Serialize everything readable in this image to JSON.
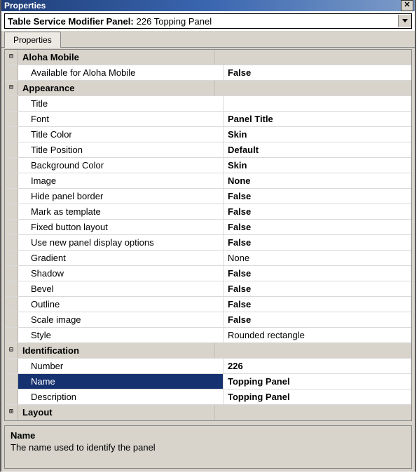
{
  "window": {
    "title": "Properties"
  },
  "selector": {
    "label": "Table Service Modifier Panel:",
    "value": "226 Topping Panel"
  },
  "tabs": [
    {
      "label": "Properties"
    }
  ],
  "groups": {
    "alohaMobile": {
      "title": "Aloha Mobile",
      "items": [
        {
          "label": "Available for Aloha Mobile",
          "value": "False",
          "bold": true
        }
      ]
    },
    "appearance": {
      "title": "Appearance",
      "items": [
        {
          "label": "Title",
          "value": "",
          "bold": false
        },
        {
          "label": "Font",
          "value": "Panel Title",
          "bold": true
        },
        {
          "label": "Title Color",
          "value": "Skin",
          "bold": true
        },
        {
          "label": "Title Position",
          "value": "Default",
          "bold": true
        },
        {
          "label": "Background Color",
          "value": "Skin",
          "bold": true
        },
        {
          "label": "Image",
          "value": "None",
          "bold": true
        },
        {
          "label": "Hide panel border",
          "value": "False",
          "bold": true
        },
        {
          "label": "Mark as template",
          "value": "False",
          "bold": true
        },
        {
          "label": "Fixed button layout",
          "value": "False",
          "bold": true
        },
        {
          "label": "Use new panel display options",
          "value": "False",
          "bold": true
        },
        {
          "label": "Gradient",
          "value": "None",
          "bold": false
        },
        {
          "label": "Shadow",
          "value": "False",
          "bold": true
        },
        {
          "label": "Bevel",
          "value": "False",
          "bold": true
        },
        {
          "label": "Outline",
          "value": "False",
          "bold": true
        },
        {
          "label": "Scale image",
          "value": "False",
          "bold": true
        },
        {
          "label": "Style",
          "value": "Rounded rectangle",
          "bold": false
        }
      ]
    },
    "identification": {
      "title": "Identification",
      "items": [
        {
          "label": "Number",
          "value": "226",
          "bold": true
        },
        {
          "label": "Name",
          "value": "Topping Panel",
          "bold": true,
          "selected": true
        },
        {
          "label": "Description",
          "value": "Topping Panel",
          "bold": true
        }
      ]
    },
    "layout": {
      "title": "Layout"
    }
  },
  "help": {
    "title": "Name",
    "text": "The name used to identify the panel"
  },
  "glyphs": {
    "minus": "⊟",
    "plus": "⊞"
  }
}
